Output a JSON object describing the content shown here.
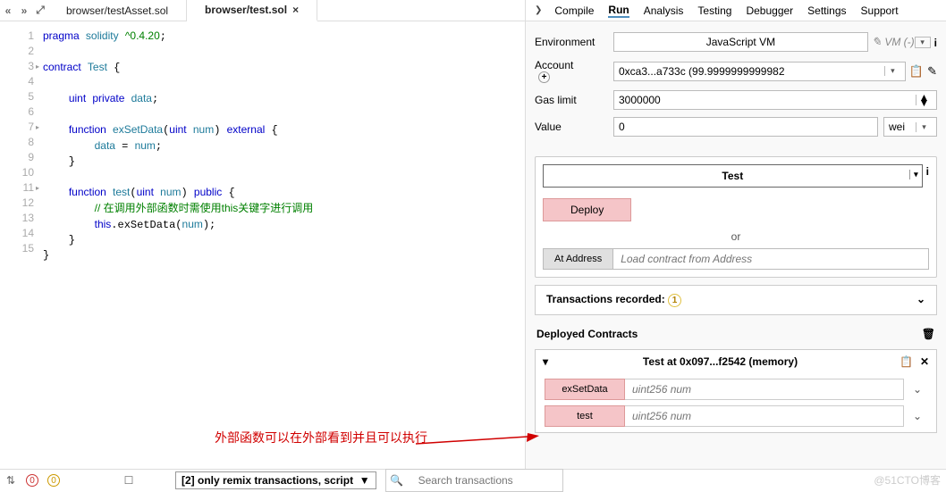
{
  "tabs": {
    "left": "«",
    "right": "»",
    "expand": "⤢",
    "items": [
      {
        "label": "browser/testAsset.sol",
        "active": false
      },
      {
        "label": "browser/test.sol",
        "active": true
      }
    ]
  },
  "editor": {
    "lines": [
      1,
      2,
      3,
      4,
      5,
      6,
      7,
      8,
      9,
      10,
      11,
      12,
      13,
      14,
      15
    ],
    "code_raw": "pragma solidity ^0.4.20;\n\ncontract Test {\n\n    uint private data;\n\n    function exSetData(uint num) external {\n        data = num;\n    }\n\n    function test(uint num) public {\n        // 在调用外部函数时需使用this关键字进行调用\n        this.exSetData(num);\n    }\n}"
  },
  "bottom": {
    "err": "0",
    "warn": "0",
    "filter": "[2] only remix transactions, script",
    "search_ph": "Search transactions"
  },
  "menu": {
    "items": [
      "Compile",
      "Run",
      "Analysis",
      "Testing",
      "Debugger",
      "Settings",
      "Support"
    ],
    "active": "Run"
  },
  "run": {
    "env_lbl": "Environment",
    "env_val": "JavaScript VM",
    "env_note": "VM (-)",
    "acct_lbl": "Account",
    "acct_val": "0xca3...a733c (99.9999999999982",
    "gas_lbl": "Gas limit",
    "gas_val": "3000000",
    "val_lbl": "Value",
    "val_val": "0",
    "val_unit": "wei",
    "contract": "Test",
    "deploy": "Deploy",
    "or": "or",
    "at_btn": "At Address",
    "at_ph": "Load contract from Address",
    "tx_label": "Transactions recorded:",
    "tx_count": "1",
    "dep_label": "Deployed Contracts",
    "instance": "Test at 0x097...f2542 (memory)",
    "funcs": [
      {
        "name": "exSetData",
        "ph": "uint256 num"
      },
      {
        "name": "test",
        "ph": "uint256 num"
      }
    ]
  },
  "annotation": "外部函数可以在外部看到并且可以执行",
  "watermark": "@51CTO博客"
}
